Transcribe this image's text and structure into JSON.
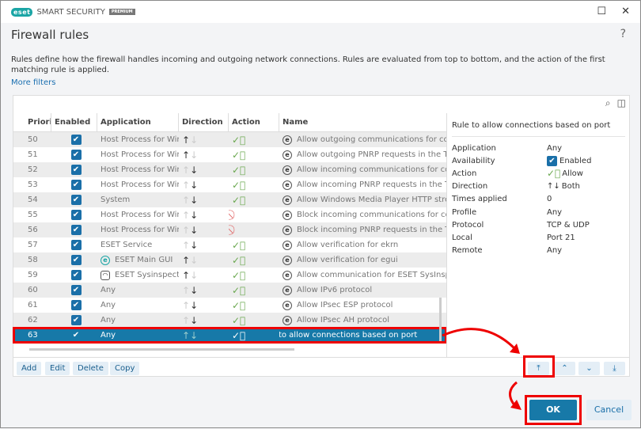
{
  "window": {
    "logo": "eset",
    "product": "SMART SECURITY",
    "edition": "PREMIUM",
    "title": "Firewall rules",
    "help": "?"
  },
  "description": "Rules define how the firewall handles incoming and outgoing network connections. Rules are evaluated from top to bottom, and the action of the first matching rule is applied.",
  "more_filters": "More filters",
  "columns": [
    "Priority",
    "Enabled",
    "Application",
    "Direction",
    "Action",
    "Name"
  ],
  "rows": [
    {
      "priority": "50",
      "app": "Host Process for Win...",
      "dir": "out",
      "action": "allow",
      "name": "Allow outgoing communications for cor"
    },
    {
      "priority": "51",
      "app": "Host Process for Win...",
      "dir": "out",
      "action": "allow",
      "name": "Allow outgoing PNRP requests in the Tru"
    },
    {
      "priority": "52",
      "app": "Host Process for Win...",
      "dir": "in",
      "action": "allow",
      "name": "Allow incoming communications for cor"
    },
    {
      "priority": "53",
      "app": "Host Process for Win...",
      "dir": "in",
      "action": "allow",
      "name": "Allow incoming PNRP requests in the Tru"
    },
    {
      "priority": "54",
      "app": "System",
      "dir": "in",
      "action": "allow",
      "name": "Allow Windows Media Player HTTP strea"
    },
    {
      "priority": "55",
      "app": "Host Process for Win...",
      "dir": "in",
      "action": "block",
      "name": "Block incoming communications for cor"
    },
    {
      "priority": "56",
      "app": "Host Process for Win...",
      "dir": "in",
      "action": "block",
      "name": "Block incoming PNRP requests in the Tru"
    },
    {
      "priority": "57",
      "app": "ESET Service",
      "dir": "in",
      "action": "allow",
      "name": "Allow verification for ekrn"
    },
    {
      "priority": "58",
      "app": "ESET Main GUI",
      "dir": "out",
      "action": "allow",
      "name": "Allow verification for egui"
    },
    {
      "priority": "59",
      "app": "ESET Sysinspector",
      "dir": "out",
      "action": "allow",
      "name": "Allow communication for ESET SysInspec"
    },
    {
      "priority": "60",
      "app": "Any",
      "dir": "in",
      "action": "allow",
      "name": "Allow IPv6 protocol"
    },
    {
      "priority": "61",
      "app": "Any",
      "dir": "in",
      "action": "allow",
      "name": "Allow IPsec ESP protocol"
    },
    {
      "priority": "62",
      "app": "Any",
      "dir": "in",
      "action": "allow",
      "name": "Allow IPsec AH protocol"
    },
    {
      "priority": "63",
      "app": "Any",
      "dir": "both",
      "action": "allow",
      "name": "Rule to allow connections based on port",
      "selected": true
    }
  ],
  "details": {
    "title": "Rule to allow connections based on port",
    "items": [
      {
        "k": "Application",
        "v": "Any"
      },
      {
        "k": "Availability",
        "v": "Enabled"
      },
      {
        "k": "Action",
        "v": "Allow"
      },
      {
        "k": "Direction",
        "v": "Both"
      },
      {
        "k": "Times applied",
        "v": "0"
      },
      {
        "k": "Profile",
        "v": "Any"
      },
      {
        "k": "Protocol",
        "v": "TCP & UDP"
      },
      {
        "k": "Local",
        "v": "Port 21"
      },
      {
        "k": "Remote",
        "v": "Any"
      }
    ]
  },
  "buttons": {
    "add": "Add",
    "edit": "Edit",
    "delete": "Delete",
    "copy": "Copy",
    "ok": "OK",
    "cancel": "Cancel"
  },
  "colors": {
    "accent": "#1779a8",
    "highlight": "#e00000",
    "allow": "#6aa84f",
    "block": "#e06060"
  }
}
